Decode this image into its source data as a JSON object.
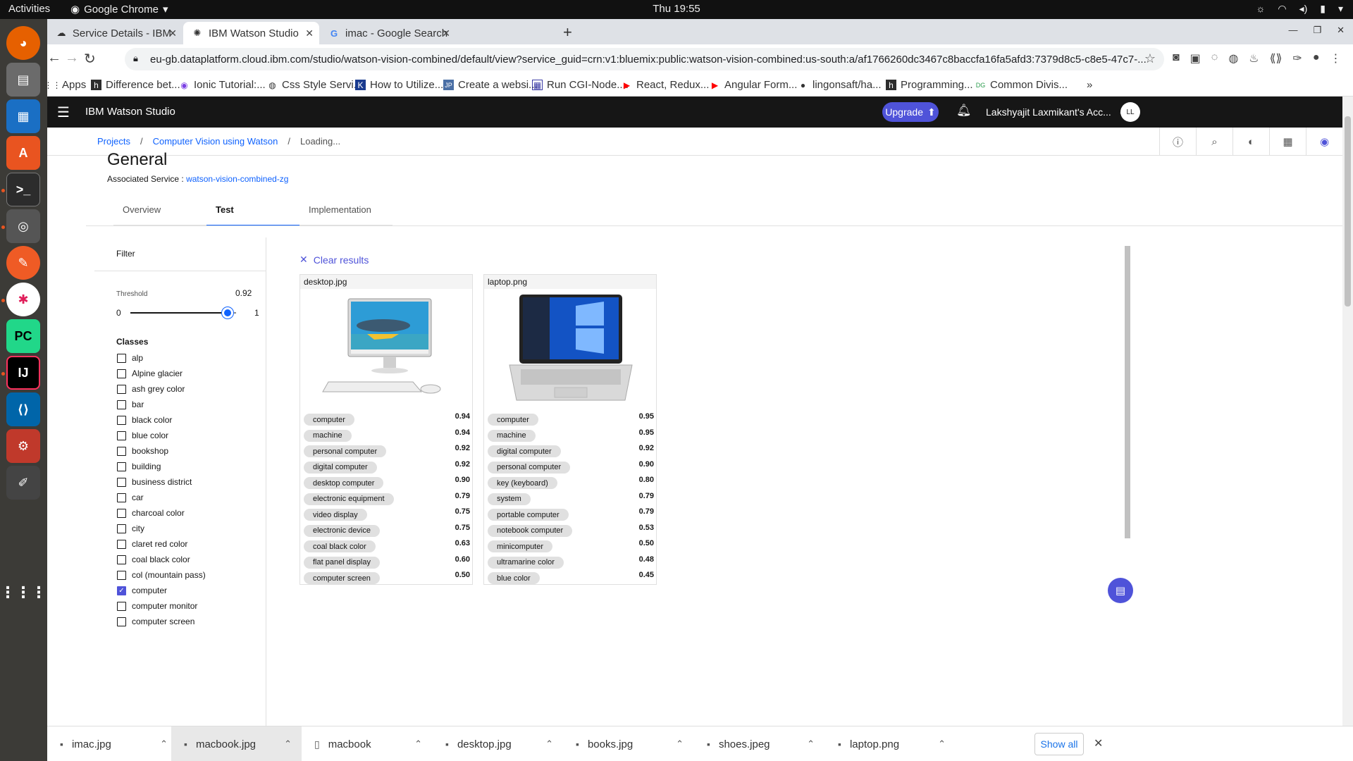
{
  "system": {
    "activities": "Activities",
    "app_name": "Google Chrome",
    "clock": "Thu 19:55"
  },
  "browser": {
    "tabs": [
      {
        "label": "Service Details - IBM Cloud"
      },
      {
        "label": "IBM Watson Studio"
      },
      {
        "label": "imac - Google Search"
      }
    ],
    "url": "eu-gb.dataplatform.cloud.ibm.com/studio/watson-vision-combined/default/view?service_guid=crn:v1:bluemix:public:watson-vision-combined:us-south:a/af1766260dc3467c8baccfa16fa5afd3:7379d8c5-c8e5-47c7-...",
    "bookmarks": [
      "Apps",
      "Difference bet...",
      "Ionic Tutorial:...",
      "Css Style Servi...",
      "How to Utilize...",
      "Create a websi...",
      "Run CGI-Node....",
      "React, Redux...",
      "Angular Form...",
      "lingonsaft/ha...",
      "Programming...",
      "Common Divis..."
    ]
  },
  "app": {
    "brand": "IBM Watson Studio",
    "upgrade": "Upgrade",
    "account": "Lakshyajit Laxmikant's Acc...",
    "avatar": "LL",
    "breadcrumb": [
      "Projects",
      "Computer Vision using Watson",
      "Loading..."
    ],
    "page_title": "General",
    "associated_label": "Associated Service :",
    "associated_service": "watson-vision-combined-zg",
    "tabs": [
      "Overview",
      "Test",
      "Implementation"
    ]
  },
  "filter": {
    "title": "Filter",
    "threshold_label": "Threshold",
    "threshold_value": "0.92",
    "threshold_level": 0.92,
    "min": "0",
    "max": "1",
    "classes_title": "Classes",
    "classes": [
      {
        "name": "alp",
        "checked": false
      },
      {
        "name": "Alpine glacier",
        "checked": false
      },
      {
        "name": "ash grey color",
        "checked": false
      },
      {
        "name": "bar",
        "checked": false
      },
      {
        "name": "black color",
        "checked": false
      },
      {
        "name": "blue color",
        "checked": false
      },
      {
        "name": "bookshop",
        "checked": false
      },
      {
        "name": "building",
        "checked": false
      },
      {
        "name": "business district",
        "checked": false
      },
      {
        "name": "car",
        "checked": false
      },
      {
        "name": "charcoal color",
        "checked": false
      },
      {
        "name": "city",
        "checked": false
      },
      {
        "name": "claret red color",
        "checked": false
      },
      {
        "name": "coal black color",
        "checked": false
      },
      {
        "name": "col (mountain pass)",
        "checked": false
      },
      {
        "name": "computer",
        "checked": true
      },
      {
        "name": "computer monitor",
        "checked": false
      },
      {
        "name": "computer screen",
        "checked": false
      }
    ]
  },
  "results": {
    "clear_label": "Clear results",
    "cards": [
      {
        "filename": "desktop.jpg",
        "items": [
          {
            "label": "computer",
            "score": "0.94"
          },
          {
            "label": "machine",
            "score": "0.94"
          },
          {
            "label": "personal computer",
            "score": "0.92"
          },
          {
            "label": "digital computer",
            "score": "0.92"
          },
          {
            "label": "desktop computer",
            "score": "0.90"
          },
          {
            "label": "electronic equipment",
            "score": "0.79"
          },
          {
            "label": "video display",
            "score": "0.75"
          },
          {
            "label": "electronic device",
            "score": "0.75"
          },
          {
            "label": "coal black color",
            "score": "0.63"
          },
          {
            "label": "flat panel display",
            "score": "0.60"
          },
          {
            "label": "computer screen",
            "score": "0.50"
          }
        ]
      },
      {
        "filename": "laptop.png",
        "items": [
          {
            "label": "computer",
            "score": "0.95"
          },
          {
            "label": "machine",
            "score": "0.95"
          },
          {
            "label": "digital computer",
            "score": "0.92"
          },
          {
            "label": "personal computer",
            "score": "0.90"
          },
          {
            "label": "key (keyboard)",
            "score": "0.80"
          },
          {
            "label": "system",
            "score": "0.79"
          },
          {
            "label": "portable computer",
            "score": "0.79"
          },
          {
            "label": "notebook computer",
            "score": "0.53"
          },
          {
            "label": "minicomputer",
            "score": "0.50"
          },
          {
            "label": "ultramarine color",
            "score": "0.48"
          },
          {
            "label": "blue color",
            "score": "0.45"
          }
        ]
      }
    ]
  },
  "downloads": {
    "items": [
      "imac.jpg",
      "macbook.jpg",
      "macbook",
      "desktop.jpg",
      "books.jpg",
      "shoes.jpeg",
      "laptop.png"
    ],
    "show_all": "Show all"
  },
  "colors": {
    "accent": "#4f53d9",
    "ibm_header": "#161616",
    "link": "#0f62fe"
  }
}
